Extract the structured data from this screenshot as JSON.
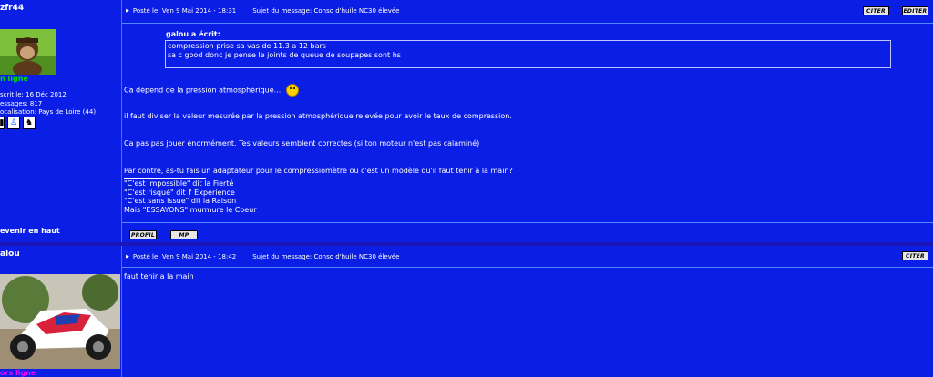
{
  "post1": {
    "username": "zfr44",
    "status": "n ligne",
    "info": {
      "inscrit": "scrit le: 16 Déc 2012",
      "messages": "essages: 817",
      "localisation": "ocalisation: Pays de Loire (44)"
    },
    "posted": "Posté le: Ven 9 Mai 2014 - 18:31",
    "subject": "Sujet du message: Conso d'huile NC30 élevée",
    "buttons": {
      "quote": "CITER",
      "edit": "EDITER",
      "profile": "PROFIL",
      "pm": "MP"
    },
    "quote": {
      "author": "galou a écrit:",
      "line1": "compression prise sa vas de 11.3 a 12 bars",
      "line2": "sa c good donc je pense le joints de queue de soupapes sont hs"
    },
    "body": {
      "line1": "Ca dépend de la pression atmosphérique....",
      "line2": "il faut diviser la valeur mesurée par la pression atmosphérique relevée pour avoir le taux de compression.",
      "line3": "Ca pas pas jouer énormément. Tes valeurs semblent correctes (si ton moteur n'est pas calaminé)",
      "line4": "Par contre, as-tu fais un adaptateur pour le compressiomètre ou c'est un modèle qu'il faut tenir à la main?"
    },
    "signature": {
      "l1": "\"C'est impossible\" dit la Fierté",
      "l2": "\"C'est risqué\" dit l' Expérience",
      "l3": "\"C'est sans issue\" dit la Raison",
      "l4": "Mais \"ESSAYONS\" murmure le Coeur"
    },
    "back_to_top": "evenir en haut"
  },
  "post2": {
    "username": "alou",
    "status": "ors ligne",
    "posted": "Posté le: Ven 9 Mai 2014 - 18:42",
    "subject": "Sujet du message: Conso d'huile NC30 élevée",
    "buttons": {
      "quote": "CITER"
    },
    "body": "faut tenir a la main"
  }
}
